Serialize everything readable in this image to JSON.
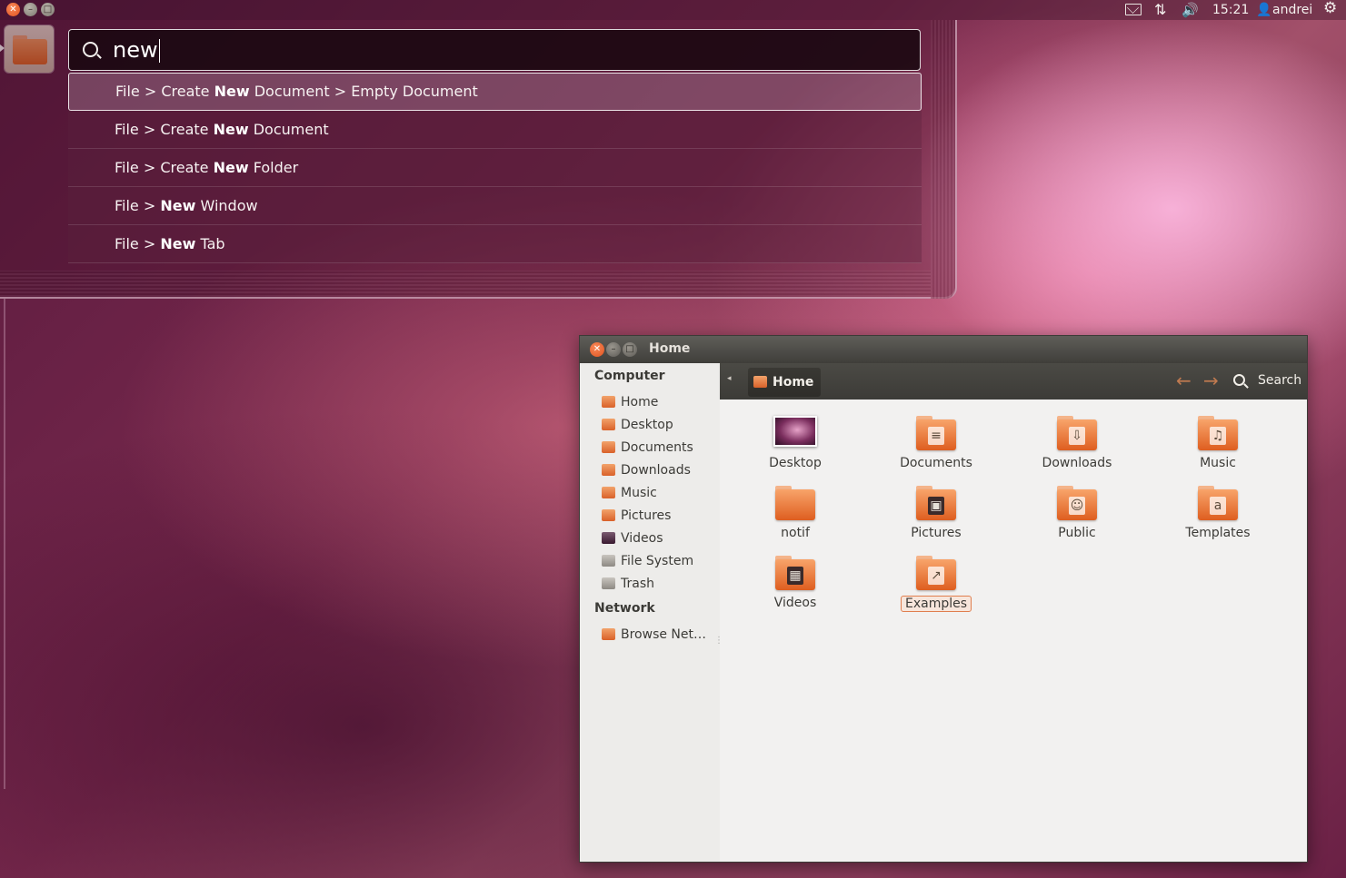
{
  "top_panel": {
    "window_controls": {
      "close": "✕",
      "minimize": "–",
      "maximize": "□"
    },
    "network_glyph": "⇅",
    "sound_glyph": "🔊",
    "clock": "15:21",
    "user_glyph": "👤",
    "user_name": "andrei",
    "session_glyph": "⚙",
    "icons": [
      "mail-icon",
      "network-icon",
      "sound-icon",
      "user-icon",
      "session-icon"
    ]
  },
  "launcher": {
    "items": [
      {
        "name": "home-folder-icon"
      }
    ]
  },
  "dash": {
    "search_value": "new",
    "results": [
      {
        "pre": "File > Create ",
        "bold": "New",
        "post": " Document > Empty Document",
        "selected": true
      },
      {
        "pre": "File > Create ",
        "bold": "New",
        "post": " Document",
        "selected": false
      },
      {
        "pre": "File > Create ",
        "bold": "New",
        "post": " Folder",
        "selected": false
      },
      {
        "pre": "File > ",
        "bold": "New",
        "post": " Window",
        "selected": false
      },
      {
        "pre": "File > ",
        "bold": "New",
        "post": " Tab",
        "selected": false
      }
    ]
  },
  "nautilus": {
    "title": "Home",
    "window_controls": {
      "close": "✕",
      "minimize": "–",
      "maximize": "□"
    },
    "sidebar": {
      "computer_heading": "Computer",
      "computer_items": [
        "Home",
        "Desktop",
        "Documents",
        "Downloads",
        "Music",
        "Pictures",
        "Videos",
        "File System",
        "Trash"
      ],
      "network_heading": "Network",
      "network_items": [
        "Browse Net…"
      ]
    },
    "toolbar": {
      "path_left_glyph": "◂",
      "path_home": "Home",
      "back_glyph": "←",
      "forward_glyph": "→",
      "search_label": "Search"
    },
    "files": [
      {
        "label": "Desktop",
        "emblem": ""
      },
      {
        "label": "Documents",
        "emblem": "≡"
      },
      {
        "label": "Downloads",
        "emblem": "⇩"
      },
      {
        "label": "Music",
        "emblem": "♫"
      },
      {
        "label": "notif",
        "emblem": ""
      },
      {
        "label": "Pictures",
        "emblem": "▣"
      },
      {
        "label": "Public",
        "emblem": "☺"
      },
      {
        "label": "Templates",
        "emblem": "a"
      },
      {
        "label": "Videos",
        "emblem": "▦"
      },
      {
        "label": "Examples",
        "emblem": "↗"
      }
    ],
    "accent_color": "#e0641e"
  }
}
